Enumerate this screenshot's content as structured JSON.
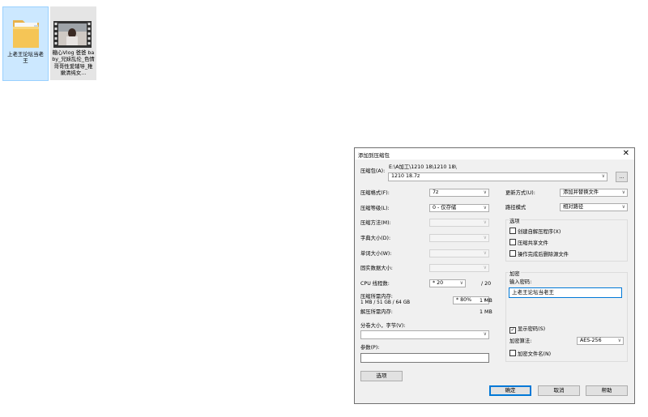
{
  "desktop": {
    "icons": [
      {
        "caption": "上老王论坛当老王"
      },
      {
        "caption": "糖心Vlog 爸爸 baby_兄妹乱伦_色情哥哥性爱辅导_稚嫩清纯女..."
      }
    ]
  },
  "dialog": {
    "title": "添加到压缩包",
    "archive": {
      "label": "压缩包(A):",
      "path": "E:\\A加工\\1210 18\\1210 18\\",
      "value": "1210 18.7z",
      "browse_label": "..."
    },
    "left": {
      "format": {
        "label": "压缩格式(F):",
        "value": "7z"
      },
      "level": {
        "label": "压缩等级(L):",
        "value": "0 - 仅存储"
      },
      "method": {
        "label": "压缩方法(M):",
        "value": ""
      },
      "dict": {
        "label": "字典大小(D):",
        "value": ""
      },
      "word": {
        "label": "单词大小(W):",
        "value": ""
      },
      "solid": {
        "label": "固实数据大小:",
        "value": ""
      },
      "threads": {
        "label": "CPU 线程数:",
        "value": "* 20",
        "max": "/ 20"
      },
      "mem_compress": {
        "label": "压缩所需内存:",
        "sub": "1 MB / 51 GB / 64 GB",
        "value": "* 80%",
        "amount": "1 MB"
      },
      "mem_decompress": {
        "label": "解压所需内存:",
        "amount": "1 MB"
      },
      "split": {
        "label": "分卷大小，字节(V):",
        "value": ""
      },
      "params": {
        "label": "参数(P):",
        "value": ""
      },
      "options_button": "选项"
    },
    "right": {
      "update": {
        "label": "更新方式(U):",
        "value": "添加并替换文件"
      },
      "pathmode": {
        "label": "路径模式",
        "value": "相对路径"
      },
      "options": {
        "title": "选项",
        "items": [
          {
            "label": "创建自解压程序(X)",
            "checked": false
          },
          {
            "label": "压缩共享文件",
            "checked": false
          },
          {
            "label": "操作完成后删除源文件",
            "checked": false
          }
        ]
      },
      "encryption": {
        "title": "加密",
        "password_label": "输入密码:",
        "password_value": "上老王论坛当老王",
        "show_password": {
          "label": "显示密码(S)",
          "checked": true
        },
        "method_label": "加密算法:",
        "method_value": "AES-256",
        "encrypt_names": {
          "label": "加密文件名(N)",
          "checked": false
        }
      }
    },
    "buttons": {
      "ok": "确定",
      "cancel": "取消",
      "help": "帮助"
    }
  },
  "colors": {
    "selection": "#cce8ff",
    "focus": "#0078d7",
    "dialog_bg": "#f0f0f0"
  }
}
